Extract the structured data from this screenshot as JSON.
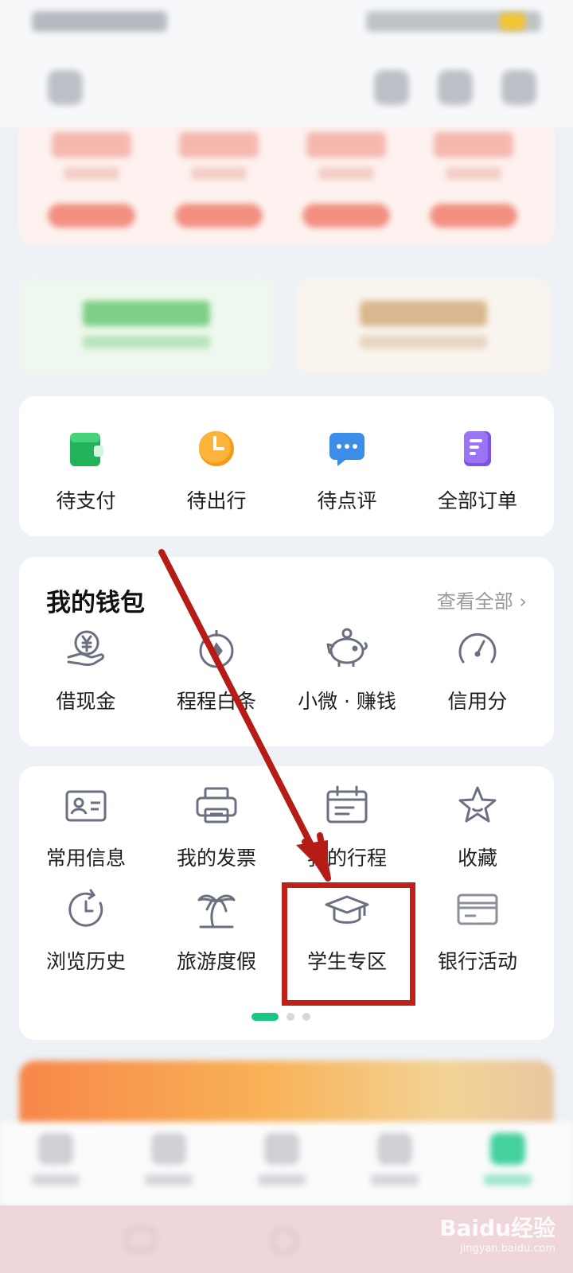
{
  "colors": {
    "accent_green": "#16c784",
    "annotation_red": "#c0201a",
    "icon_gray": "#6b7080"
  },
  "orders": {
    "items": [
      {
        "label": "待支付",
        "icon": "wallet-icon"
      },
      {
        "label": "待出行",
        "icon": "clock-icon"
      },
      {
        "label": "待点评",
        "icon": "comment-icon"
      },
      {
        "label": "全部订单",
        "icon": "order-list-icon"
      }
    ]
  },
  "wallet": {
    "title": "我的钱包",
    "more": "查看全部",
    "items": [
      {
        "label": "借现金",
        "icon": "yuan-hand-icon"
      },
      {
        "label": "程程白条",
        "icon": "compass-icon"
      },
      {
        "label": "小微 · 赚钱",
        "icon": "piggy-bank-icon"
      },
      {
        "label": "信用分",
        "icon": "speedometer-icon"
      }
    ]
  },
  "services": {
    "items": [
      {
        "label": "常用信息",
        "icon": "id-card-icon"
      },
      {
        "label": "我的发票",
        "icon": "printer-icon"
      },
      {
        "label": "我的行程",
        "icon": "calendar-icon"
      },
      {
        "label": "收藏",
        "icon": "star-icon"
      },
      {
        "label": "浏览历史",
        "icon": "history-icon"
      },
      {
        "label": "旅游度假",
        "icon": "palm-tree-icon"
      },
      {
        "label": "学生专区",
        "icon": "graduation-cap-icon"
      },
      {
        "label": "银行活动",
        "icon": "bank-card-icon"
      }
    ],
    "page_count": 3,
    "active_page": 1
  },
  "watermark": {
    "main": "Baidu经验",
    "sub": "jingyan.baidu.com"
  }
}
